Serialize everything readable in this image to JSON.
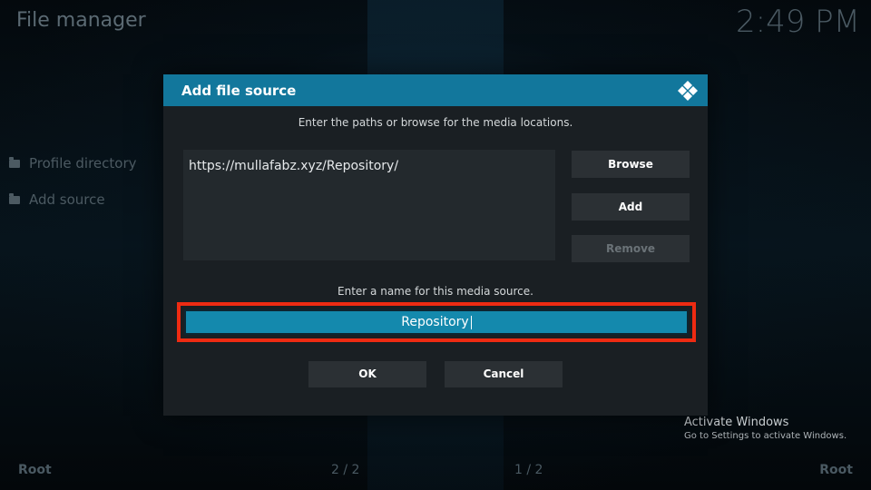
{
  "app": {
    "title": "File manager",
    "clock": "2:49 PM"
  },
  "sidebar": {
    "items": [
      {
        "label": "Profile directory",
        "icon": "folder-icon"
      },
      {
        "label": "Add source",
        "icon": "folder-icon"
      }
    ]
  },
  "footer": {
    "left_label": "Root",
    "left_pages": "2 / 2",
    "right_pages": "1 / 2",
    "right_label": "Root"
  },
  "watermark": {
    "title": "Activate Windows",
    "subtitle": "Go to Settings to activate Windows."
  },
  "dialog": {
    "title": "Add file source",
    "logo_icon": "kodi-logo-icon",
    "paths_instruction": "Enter the paths or browse for the media locations.",
    "path_value": "https://mullafabz.xyz/Repository/",
    "browse_label": "Browse",
    "add_label": "Add",
    "remove_label": "Remove",
    "name_instruction": "Enter a name for this media source.",
    "name_value": "Repository",
    "ok_label": "OK",
    "cancel_label": "Cancel"
  },
  "colors": {
    "accent": "#12779c",
    "field_active": "#1489ad",
    "highlight_outline": "#ee2b12",
    "dialog_bg": "#1a1f23"
  }
}
